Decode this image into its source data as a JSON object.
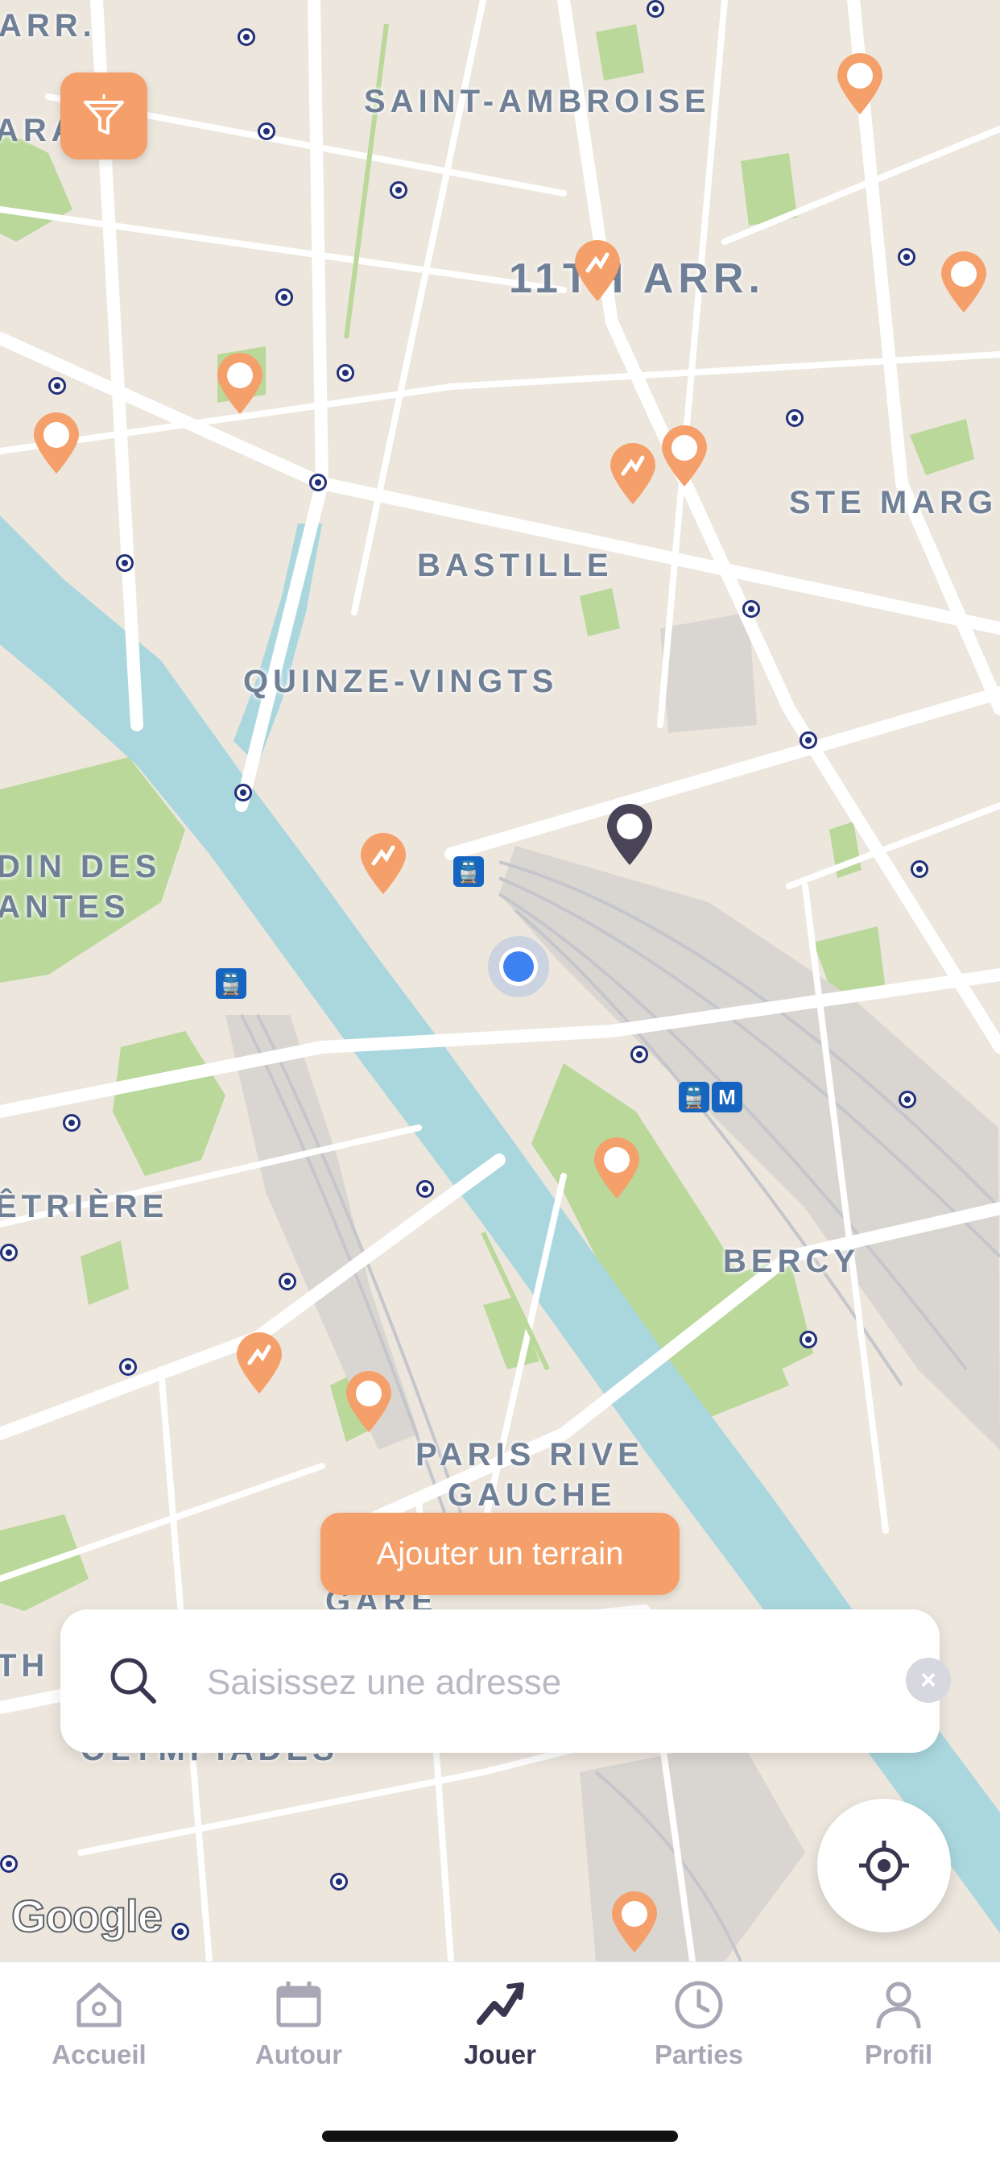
{
  "map": {
    "area_labels": {
      "arr_top": "ARR.",
      "saint_ambroise": "SAINT-AMBROISE",
      "arr_11": "11TH ARR.",
      "ste_marg": "STE MARG",
      "bastille": "BASTILLE",
      "quinze_vingts": "QUINZE-VINGTS",
      "jardin_line1": "DIN DES",
      "jardin_line2": "ANTES",
      "salpetriere": "ÊTRIÈRE",
      "bercy": "BERCY",
      "rive_gauche_line1": "PARIS RIVE",
      "rive_gauche_line2": "GAUCHE",
      "gare": "GARE",
      "olympiades": "OLYMPIADES",
      "left_th": "TH",
      "left_ara": "ARA"
    },
    "transit_badge_metro": "M",
    "attribution": "Google"
  },
  "colors": {
    "accent": "#f5a06a",
    "pin_orange": "#f5a06a",
    "pin_dark": "#4a4458",
    "user_location": "#3d82f0",
    "water": "#aad7de",
    "park": "#b9d89a",
    "tab_active": "#3b3550",
    "tab_inactive": "#a7a7b5"
  },
  "actions": {
    "add_field_label": "Ajouter un terrain"
  },
  "search": {
    "placeholder": "Saisissez une adresse",
    "value": ""
  },
  "tabs": [
    {
      "label": "Accueil",
      "icon": "home-icon",
      "active": false
    },
    {
      "label": "Autour",
      "icon": "calendar-icon",
      "active": false
    },
    {
      "label": "Jouer",
      "icon": "play-icon",
      "active": true
    },
    {
      "label": "Parties",
      "icon": "clock-icon",
      "active": false
    },
    {
      "label": "Profil",
      "icon": "user-icon",
      "active": false
    }
  ]
}
